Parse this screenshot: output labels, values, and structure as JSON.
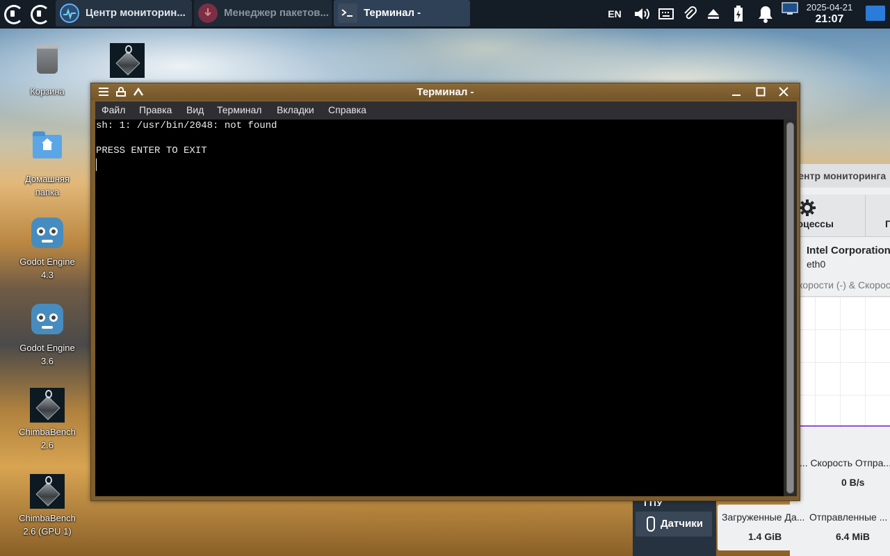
{
  "taskbar": {
    "tasks": [
      {
        "label": "Центр мониторин...",
        "state": "normal"
      },
      {
        "label": "Менеджер пакетов...",
        "state": "inactive"
      },
      {
        "label": "Терминал -",
        "state": "active"
      }
    ],
    "tray": {
      "language": "EN",
      "icons": [
        "volume-icon",
        "keyboard-icon",
        "paperclip-icon",
        "eject-icon",
        "battery-charging-icon",
        "notifications-bell-icon",
        "network-display-icon"
      ]
    },
    "clock": {
      "date": "2025-04-21",
      "time": "21:07"
    }
  },
  "desktop": {
    "icons": [
      {
        "label": "Корзина",
        "kind": "trash"
      },
      {
        "label": "Домашняя папка",
        "kind": "home-folder"
      },
      {
        "label": "Godot Engine 4.3",
        "kind": "godot"
      },
      {
        "label": "Godot Engine 3.6",
        "kind": "godot"
      },
      {
        "label": "ChimbaBench 2.6",
        "kind": "chimbabench"
      },
      {
        "label": "ChimbaBench 2.6 (GPU 1)",
        "kind": "chimbabench"
      },
      {
        "label": "",
        "kind": "chimbabench"
      }
    ]
  },
  "monitor_window": {
    "title": "Центр мониторинга",
    "tab_processes": "Процессы",
    "tab_next": "П",
    "network_name": "Intel Corporation",
    "network_device": "eth0",
    "graph_legend": "Скорости (-) & Скорость Отп",
    "send_speed_header": "... Скорость Отпра...",
    "send_speed_value": "0 B/s",
    "downloaded_header": "Загруженные Да...",
    "downloaded_value": "1.4 GiB",
    "sent_header": "Отправленные ...",
    "sent_value": "6.4 MiB",
    "sidebar_prev": "ГПУ",
    "sidebar_sensors": "Датчики"
  },
  "terminal": {
    "title": "Терминал -",
    "menu": [
      "Файл",
      "Правка",
      "Вид",
      "Терминал",
      "Вкладки",
      "Справка"
    ],
    "output_lines": [
      "sh: 1: /usr/bin/2048: not found",
      "",
      "PRESS ENTER TO EXIT"
    ]
  }
}
